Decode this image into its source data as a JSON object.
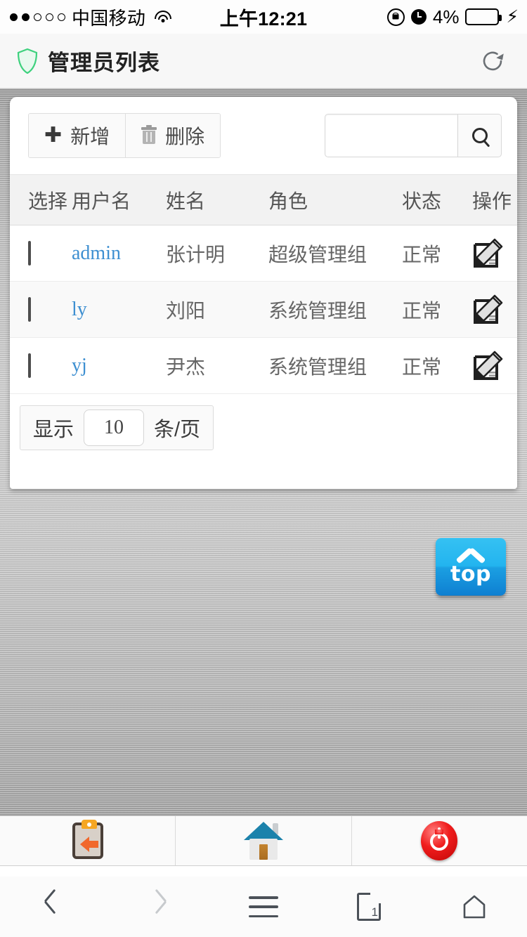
{
  "status_bar": {
    "signal_dots_filled": 2,
    "signal_dots_total": 5,
    "carrier": "中国移动",
    "wifi_icon": "wifi-icon",
    "time": "上午12:21",
    "rotation_lock_icon": "rotation-lock-icon",
    "alarm_icon": "alarm-clock-icon",
    "battery_percent": "4%",
    "battery_level": 4,
    "charging_icon": "lightning-bolt-icon",
    "battery_color": "#ff2b20"
  },
  "header": {
    "shield_icon": "shield-icon",
    "shield_color": "#3ed17e",
    "title": "管理员列表",
    "refresh_icon": "refresh-icon"
  },
  "toolbar": {
    "add_label": "新增",
    "add_icon": "plus-icon",
    "delete_label": "删除",
    "delete_icon": "trash-icon",
    "search_value": "",
    "search_placeholder": "",
    "search_icon": "search-icon"
  },
  "table": {
    "columns": [
      "选择",
      "用户名",
      "姓名",
      "角色",
      "状态",
      "操作"
    ],
    "rows": [
      {
        "checked": false,
        "username": "admin",
        "fullname": "张计明",
        "role": "超级管理组",
        "status": "正常",
        "action_icon": "edit-icon"
      },
      {
        "checked": false,
        "username": "ly",
        "fullname": "刘阳",
        "role": "系统管理组",
        "status": "正常",
        "action_icon": "edit-icon"
      },
      {
        "checked": false,
        "username": "yj",
        "fullname": "尹杰",
        "role": "系统管理组",
        "status": "正常",
        "action_icon": "edit-icon"
      }
    ],
    "link_color": "#3d8fd1"
  },
  "pagination": {
    "prefix_label": "显示",
    "page_size": "10",
    "suffix_label": "条/页"
  },
  "back_to_top": {
    "label": "top",
    "chevron_icon": "chevron-up-icon",
    "color": "#23b4ef"
  },
  "app_toolbar": {
    "items": [
      {
        "name": "back-clipboard-icon"
      },
      {
        "name": "home-icon"
      },
      {
        "name": "power-icon"
      }
    ]
  },
  "browser_nav": {
    "items": [
      {
        "name": "nav-back-icon",
        "enabled": true
      },
      {
        "name": "nav-forward-icon",
        "enabled": false
      },
      {
        "name": "nav-menu-icon",
        "enabled": true
      },
      {
        "name": "nav-tabs-icon",
        "enabled": true,
        "count": "1"
      },
      {
        "name": "nav-home-icon",
        "enabled": true
      }
    ]
  }
}
